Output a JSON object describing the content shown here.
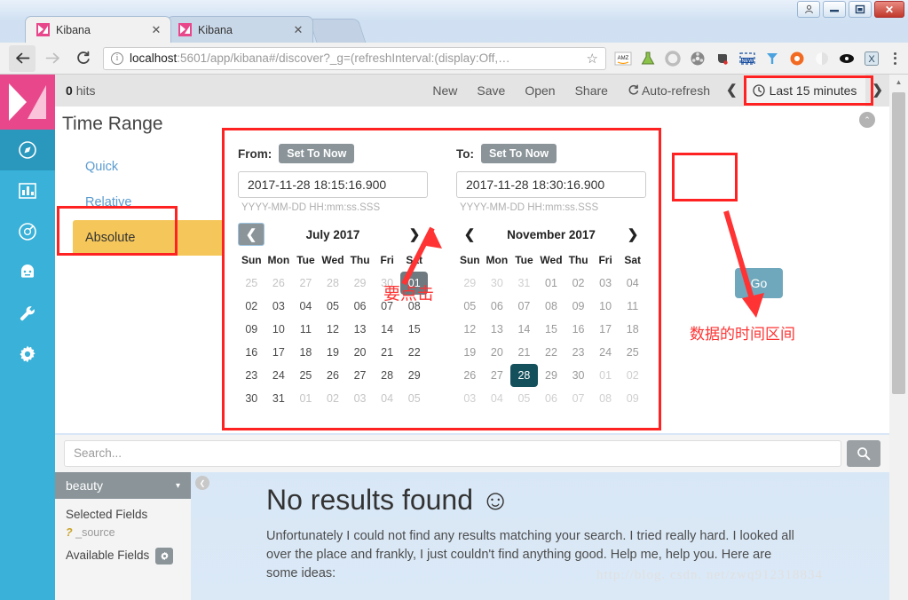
{
  "window": {
    "buttons": [
      {
        "name": "user-account",
        "glyph": "person"
      },
      {
        "name": "minimize",
        "glyph": "—"
      },
      {
        "name": "maximize",
        "glyph": "▢"
      },
      {
        "name": "close",
        "glyph": "✕"
      }
    ]
  },
  "browser": {
    "tabs": [
      {
        "title": "Kibana",
        "active": true,
        "close": "✕"
      },
      {
        "title": "Kibana",
        "active": false,
        "close": "✕"
      }
    ],
    "back_glyph": "←",
    "forward_glyph": "→",
    "reload_glyph": "C",
    "omnibox": {
      "info_glyph": "i",
      "url_strong": "localhost",
      "url_rest": ":5601/app/kibana#/discover?_g=(refreshInterval:(display:Off,…",
      "star_glyph": "☆"
    },
    "extensions": [
      {
        "name": "amazon-assistant-icon",
        "label": "AMZ"
      },
      {
        "name": "flask-icon",
        "label": "flask"
      },
      {
        "name": "circle-icon",
        "label": "circle"
      },
      {
        "name": "film-reel-icon",
        "label": "reel"
      },
      {
        "name": "evernote-icon",
        "label": "evernote"
      },
      {
        "name": "new-clip-icon",
        "label": "NEW"
      },
      {
        "name": "y-logo-icon",
        "label": "Y"
      },
      {
        "name": "lifebuoy-icon",
        "label": "buoy"
      },
      {
        "name": "moon-icon",
        "label": "moon"
      },
      {
        "name": "eye-icon",
        "label": "eye"
      },
      {
        "name": "x-box-icon",
        "label": "X"
      }
    ],
    "menu_glyph": "⋮"
  },
  "kibana": {
    "sidebar": [
      {
        "name": "logo",
        "label": "Kibana"
      },
      {
        "name": "discover",
        "label": "Discover",
        "selected": true
      },
      {
        "name": "visualize",
        "label": "Visualize",
        "selected": false
      },
      {
        "name": "dashboard",
        "label": "Dashboard",
        "selected": false
      },
      {
        "name": "timelion",
        "label": "Timelion",
        "selected": false
      },
      {
        "name": "dev-tools",
        "label": "Dev Tools",
        "selected": false
      },
      {
        "name": "management",
        "label": "Management",
        "selected": false
      }
    ],
    "topnav": {
      "hits_count": "0",
      "hits_label": "hits",
      "links": [
        "New",
        "Save",
        "Open",
        "Share"
      ],
      "autorefresh": "Auto-refresh",
      "autorefresh_icon": "↻",
      "prev_glyph": "❮",
      "next_glyph": "❯",
      "timepicker_label": "Last 15 minutes",
      "clock_glyph": "🕓"
    },
    "time_range": {
      "title": "Time Range",
      "tabs": [
        {
          "label": "Quick",
          "active": false
        },
        {
          "label": "Relative",
          "active": false
        },
        {
          "label": "Absolute",
          "active": true
        }
      ],
      "collapse_glyph": "⌃",
      "from": {
        "label": "From:",
        "set_to_now": "Set To Now",
        "value": "2017-11-28 18:15:16.900",
        "hint": "YYYY-MM-DD HH:mm:ss.SSS"
      },
      "to": {
        "label": "To:",
        "set_to_now": "Set To Now",
        "value": "2017-11-28 18:30:16.900",
        "hint": "YYYY-MM-DD HH:mm:ss.SSS"
      },
      "go_label": "Go",
      "calendars": [
        {
          "id": "left",
          "month": "July 2017",
          "prev_glyph": "❮",
          "next_glyph": "❯",
          "dow": [
            "Sun",
            "Mon",
            "Tue",
            "Wed",
            "Thu",
            "Fri",
            "Sat"
          ],
          "weeks": [
            [
              {
                "d": "25",
                "s": "mute"
              },
              {
                "d": "26",
                "s": "mute"
              },
              {
                "d": "27",
                "s": "mute"
              },
              {
                "d": "28",
                "s": "mute"
              },
              {
                "d": "29",
                "s": "mute"
              },
              {
                "d": "30",
                "s": "mute"
              },
              {
                "d": "01",
                "s": "sel-gray"
              }
            ],
            [
              {
                "d": "02",
                "s": ""
              },
              {
                "d": "03",
                "s": ""
              },
              {
                "d": "04",
                "s": ""
              },
              {
                "d": "05",
                "s": ""
              },
              {
                "d": "06",
                "s": ""
              },
              {
                "d": "07",
                "s": ""
              },
              {
                "d": "08",
                "s": ""
              }
            ],
            [
              {
                "d": "09",
                "s": ""
              },
              {
                "d": "10",
                "s": ""
              },
              {
                "d": "11",
                "s": ""
              },
              {
                "d": "12",
                "s": ""
              },
              {
                "d": "13",
                "s": ""
              },
              {
                "d": "14",
                "s": ""
              },
              {
                "d": "15",
                "s": ""
              }
            ],
            [
              {
                "d": "16",
                "s": ""
              },
              {
                "d": "17",
                "s": ""
              },
              {
                "d": "18",
                "s": ""
              },
              {
                "d": "19",
                "s": ""
              },
              {
                "d": "20",
                "s": ""
              },
              {
                "d": "21",
                "s": ""
              },
              {
                "d": "22",
                "s": ""
              }
            ],
            [
              {
                "d": "23",
                "s": ""
              },
              {
                "d": "24",
                "s": ""
              },
              {
                "d": "25",
                "s": ""
              },
              {
                "d": "26",
                "s": ""
              },
              {
                "d": "27",
                "s": ""
              },
              {
                "d": "28",
                "s": ""
              },
              {
                "d": "29",
                "s": ""
              }
            ],
            [
              {
                "d": "30",
                "s": ""
              },
              {
                "d": "31",
                "s": ""
              },
              {
                "d": "01",
                "s": "mute"
              },
              {
                "d": "02",
                "s": "mute"
              },
              {
                "d": "03",
                "s": "mute"
              },
              {
                "d": "04",
                "s": "mute"
              },
              {
                "d": "05",
                "s": "mute"
              }
            ]
          ]
        },
        {
          "id": "right",
          "month": "November 2017",
          "prev_glyph": "❮",
          "next_glyph": "❯",
          "dow": [
            "Sun",
            "Mon",
            "Tue",
            "Wed",
            "Thu",
            "Fri",
            "Sat"
          ],
          "weeks": [
            [
              {
                "d": "29",
                "s": "mute"
              },
              {
                "d": "30",
                "s": "mute"
              },
              {
                "d": "31",
                "s": "mute"
              },
              {
                "d": "01",
                "s": ""
              },
              {
                "d": "02",
                "s": ""
              },
              {
                "d": "03",
                "s": ""
              },
              {
                "d": "04",
                "s": ""
              }
            ],
            [
              {
                "d": "05",
                "s": ""
              },
              {
                "d": "06",
                "s": ""
              },
              {
                "d": "07",
                "s": ""
              },
              {
                "d": "08",
                "s": ""
              },
              {
                "d": "09",
                "s": ""
              },
              {
                "d": "10",
                "s": ""
              },
              {
                "d": "11",
                "s": ""
              }
            ],
            [
              {
                "d": "12",
                "s": ""
              },
              {
                "d": "13",
                "s": ""
              },
              {
                "d": "14",
                "s": ""
              },
              {
                "d": "15",
                "s": ""
              },
              {
                "d": "16",
                "s": ""
              },
              {
                "d": "17",
                "s": ""
              },
              {
                "d": "18",
                "s": ""
              }
            ],
            [
              {
                "d": "19",
                "s": ""
              },
              {
                "d": "20",
                "s": ""
              },
              {
                "d": "21",
                "s": ""
              },
              {
                "d": "22",
                "s": ""
              },
              {
                "d": "23",
                "s": ""
              },
              {
                "d": "24",
                "s": ""
              },
              {
                "d": "25",
                "s": ""
              }
            ],
            [
              {
                "d": "26",
                "s": ""
              },
              {
                "d": "27",
                "s": ""
              },
              {
                "d": "28",
                "s": "sel-teal"
              },
              {
                "d": "29",
                "s": ""
              },
              {
                "d": "30",
                "s": ""
              },
              {
                "d": "01",
                "s": "mute"
              },
              {
                "d": "02",
                "s": "mute"
              }
            ],
            [
              {
                "d": "03",
                "s": "mute"
              },
              {
                "d": "04",
                "s": "mute"
              },
              {
                "d": "05",
                "s": "mute"
              },
              {
                "d": "06",
                "s": "mute"
              },
              {
                "d": "07",
                "s": "mute"
              },
              {
                "d": "08",
                "s": "mute"
              },
              {
                "d": "09",
                "s": "mute"
              }
            ]
          ]
        }
      ]
    },
    "search": {
      "placeholder": "Search...",
      "value": "",
      "button_icon": "search-icon"
    },
    "fields": {
      "index_pattern": "beauty",
      "caret_glyph": "▾",
      "selected_fields_label": "Selected Fields",
      "selected_fields": [
        {
          "type": "?",
          "name": "_source"
        }
      ],
      "available_fields_label": "Available Fields",
      "gear_glyph": "✿",
      "collapse_glyph": "❮"
    },
    "results": {
      "title": "No results found ☺",
      "body": "Unfortunately I could not find any results matching your search. I tried really hard. I looked all over the place and frankly, I just couldn't find anything good. Help me, help you. Here are some ideas:"
    }
  },
  "annotations": {
    "color": "#ff3333",
    "click_here": "要点击",
    "data_time_range": "数据的时间区间"
  },
  "watermark": "http://blog. csdn. net/zwq912318834",
  "colors": {
    "kibana_blue": "#39b1d8",
    "kibana_pink": "#e8488b",
    "absolute_tab_yellow": "#f5c75a",
    "go_button": "#6fa8bc",
    "selected_day_gray": "#6e7a80",
    "selected_day_teal": "#14505c",
    "annotation_red": "#ff3333"
  }
}
